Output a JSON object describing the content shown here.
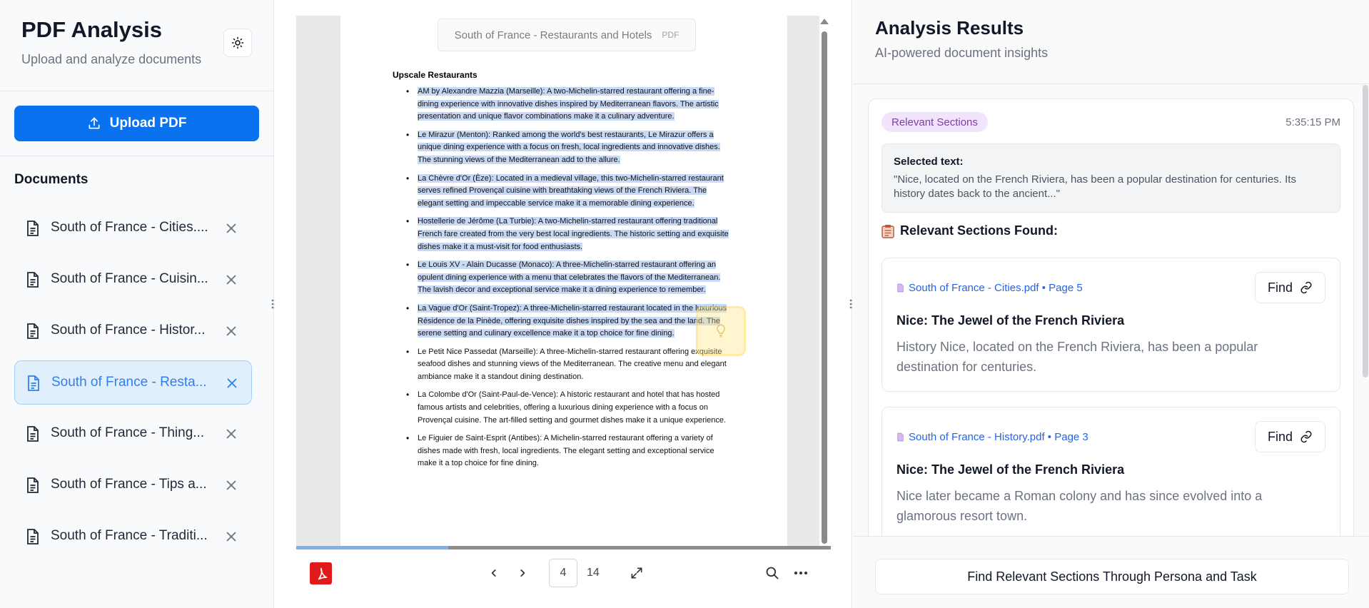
{
  "sidebar": {
    "title": "PDF Analysis",
    "subtitle": "Upload and analyze documents",
    "upload_label": "Upload PDF",
    "documents_title": "Documents",
    "documents": [
      {
        "label": "South of France - Cities....",
        "active": false
      },
      {
        "label": "South of France - Cuisin...",
        "active": false
      },
      {
        "label": "South of France - Histor...",
        "active": false
      },
      {
        "label": "South of France - Resta...",
        "active": true
      },
      {
        "label": "South of France - Thing...",
        "active": false
      },
      {
        "label": "South of France - Tips a...",
        "active": false
      },
      {
        "label": "South of France - Traditi...",
        "active": false
      }
    ]
  },
  "viewer": {
    "doc_title": "South of France - Restaurants and Hotels",
    "doc_type": "PDF",
    "section_heading": "Upscale Restaurants",
    "items": [
      {
        "text": "AM by Alexandre Mazzia (Marseille): A two-Michelin-starred restaurant offering a fine-dining experience with innovative dishes inspired by Mediterranean flavors. The artistic presentation and unique flavor combinations make it a culinary adventure.",
        "highlighted": true
      },
      {
        "text": "Le Mirazur (Menton): Ranked among the world's best restaurants, Le Mirazur offers a unique dining experience with a focus on fresh, local ingredients and innovative dishes. The stunning views of the Mediterranean add to the allure.",
        "highlighted": true
      },
      {
        "text": "La Chèvre d'Or (Èze): Located in a medieval village, this two-Michelin-starred restaurant serves refined Provençal cuisine with breathtaking views of the French Riviera. The elegant setting and impeccable service make it a memorable dining experience.",
        "highlighted": true
      },
      {
        "text": "Hostellerie de Jérôme (La Turbie): A two-Michelin-starred restaurant offering traditional French fare created from the very best local ingredients. The historic setting and exquisite dishes make it a must-visit for food enthusiasts.",
        "highlighted": true
      },
      {
        "text": "Le Louis XV - Alain Ducasse (Monaco): A three-Michelin-starred restaurant offering an opulent dining experience with a menu that celebrates the flavors of the Mediterranean. The lavish decor and exceptional service make it a dining experience to remember.",
        "highlighted": true
      },
      {
        "text": "La Vague d'Or (Saint-Tropez): A three-Michelin-starred restaurant located in the luxurious Résidence de la Pinède, offering exquisite dishes inspired by the sea and the land. The serene setting and culinary excellence make it a top choice for fine dining.",
        "highlighted": true
      },
      {
        "text": "Le Petit Nice Passedat (Marseille): A three-Michelin-starred restaurant offering exquisite seafood dishes and stunning views of the Mediterranean. The creative menu and elegant ambiance make it a standout dining destination.",
        "highlighted": false
      },
      {
        "text": "La Colombe d'Or (Saint-Paul-de-Vence): A historic restaurant and hotel that has hosted famous artists and celebrities, offering a luxurious dining experience with a focus on Provençal cuisine. The art-filled setting and gourmet dishes make it a unique experience.",
        "highlighted": false
      },
      {
        "text": "Le Figuier de Saint-Esprit (Antibes): A Michelin-starred restaurant offering a variety of dishes made with fresh, local ingredients. The elegant setting and exceptional service make it a top choice for fine dining.",
        "highlighted": false
      }
    ],
    "current_page": "4",
    "total_pages": "14",
    "scroll_progress": 0.285
  },
  "results": {
    "title": "Analysis Results",
    "subtitle": "AI-powered document insights",
    "badge": "Relevant Sections",
    "time": "5:35:15 PM",
    "selected_label": "Selected text:",
    "selected_text": "\"Nice, located on the French Riviera, has been a popular destination for centuries. Its history dates back to the ancient...\"",
    "found_label": "Relevant Sections Found:",
    "sections": [
      {
        "source": "South of France - Cities.pdf • Page 5",
        "find_label": "Find",
        "title": "Nice: The Jewel of the French Riviera",
        "desc": "History Nice, located on the French Riviera, has been a popular destination for centuries."
      },
      {
        "source": "South of France - History.pdf • Page 3",
        "find_label": "Find",
        "title": "Nice: The Jewel of the French Riviera",
        "desc": "Nice later became a Roman colony and has since evolved into a glamorous resort town."
      }
    ],
    "footer_button": "Find Relevant Sections Through Persona and Task"
  },
  "colors": {
    "accent": "#0a72ef",
    "active_bg": "#e1eefc",
    "highlight": "#c8d9f5",
    "badge_bg": "#f1e4fb",
    "badge_text": "#7b3fa9",
    "link": "#2563eb",
    "pdf_red": "#e01a1a"
  },
  "icons": [
    "sun-icon",
    "upload-icon",
    "file-icon",
    "close-icon",
    "drag-handle-icon",
    "lightbulb-icon",
    "pdf-logo-icon",
    "chevron-left-icon",
    "chevron-right-icon",
    "fullscreen-icon",
    "search-icon",
    "more-icon",
    "clipboard-icon",
    "link-icon"
  ]
}
